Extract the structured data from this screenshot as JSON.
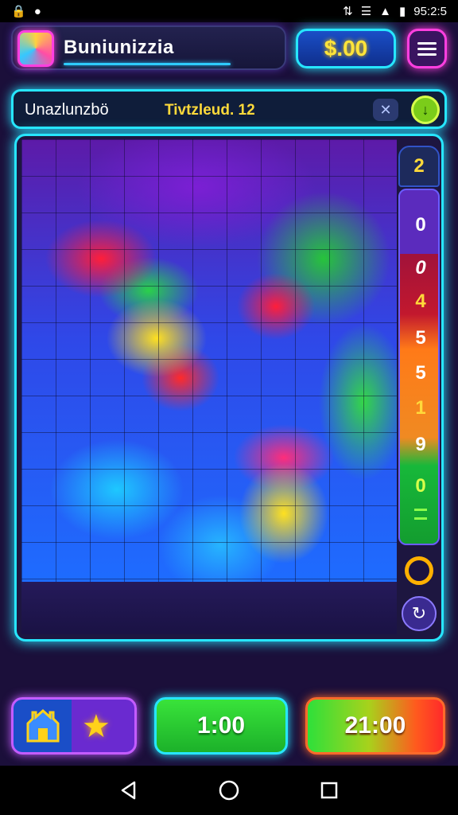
{
  "status_bar": {
    "time": "95:2:5",
    "left_icons": [
      "lock-icon",
      "cat-icon"
    ],
    "right_icons": [
      "vibrate-icon",
      "wifi-icon",
      "signal-icon",
      "battery-icon"
    ]
  },
  "header": {
    "app_title": "Buniunizzia",
    "coins": "$.00"
  },
  "info_bar": {
    "puzzle_name": "Unazlunzbö",
    "level": "Tivtzleud. 12"
  },
  "side_rail": {
    "top_value": "2",
    "digits": [
      "0",
      "0",
      "4",
      "5",
      "5",
      "1",
      "9",
      "0"
    ]
  },
  "bottom_bar": {
    "time_button": "1:00",
    "score_button": "21:00"
  },
  "colors": {
    "accent": "#27e6ff",
    "magenta": "#ff3fe0",
    "coin_text": "#ffe43a",
    "background": "#1b0f3a"
  }
}
